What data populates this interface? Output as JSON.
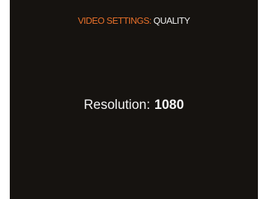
{
  "header": {
    "category": "VIDEO SETTINGS:",
    "page": "QUALITY"
  },
  "setting": {
    "label": "Resolution:",
    "value": "1080"
  },
  "colors": {
    "background": "#161310",
    "accent": "#e8702a",
    "text": "#f2f2f2"
  }
}
